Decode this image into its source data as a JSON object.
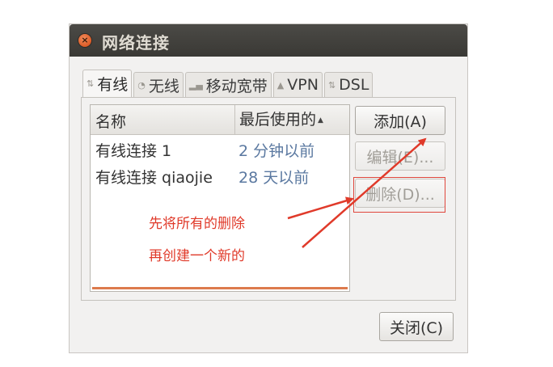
{
  "window": {
    "title": "网络连接"
  },
  "tabs": [
    {
      "label": "有线",
      "active": true
    },
    {
      "label": "无线",
      "active": false
    },
    {
      "label": "移动宽带",
      "active": false
    },
    {
      "label": "VPN",
      "active": false
    },
    {
      "label": "DSL",
      "active": false
    }
  ],
  "list": {
    "columns": [
      "名称",
      "最后使用的"
    ],
    "rows": [
      {
        "name": "有线连接 1",
        "last_used": "2 分钟以前"
      },
      {
        "name": "有线连接 qiaojie",
        "last_used": "28 天以前"
      }
    ]
  },
  "buttons": {
    "add": "添加(A)",
    "edit": "编辑(E)...",
    "delete": "删除(D)...",
    "close": "关闭(C)"
  },
  "annotations": {
    "line1": "先将所有的删除",
    "line2": "再创建一个新的",
    "color": "#e03a2a"
  },
  "colors": {
    "titlebar": "#3c3b37",
    "close_button": "#e5581f",
    "accent_line": "#dd7a4c",
    "time_text": "#5a78a0"
  }
}
